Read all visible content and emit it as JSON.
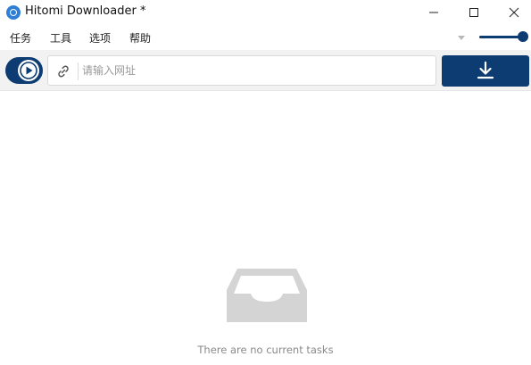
{
  "window": {
    "title": "Hitomi Downloader *"
  },
  "menu": {
    "items": [
      {
        "label": "任务"
      },
      {
        "label": "工具"
      },
      {
        "label": "选项"
      },
      {
        "label": "帮助"
      }
    ]
  },
  "toolbar": {
    "url_placeholder": "请输入网址",
    "url_value": ""
  },
  "empty_state": {
    "message": "There are no current tasks"
  },
  "colors": {
    "accent": "#0c3c72",
    "toolbar_bg": "#f2f2f2",
    "empty_icon": "#d4d4d4"
  },
  "icons": {
    "app": "hitomi-app-icon",
    "link": "link-icon",
    "play": "play-icon",
    "download": "download-icon",
    "empty": "inbox-tray-icon"
  },
  "slider": {
    "level": 1.0
  }
}
